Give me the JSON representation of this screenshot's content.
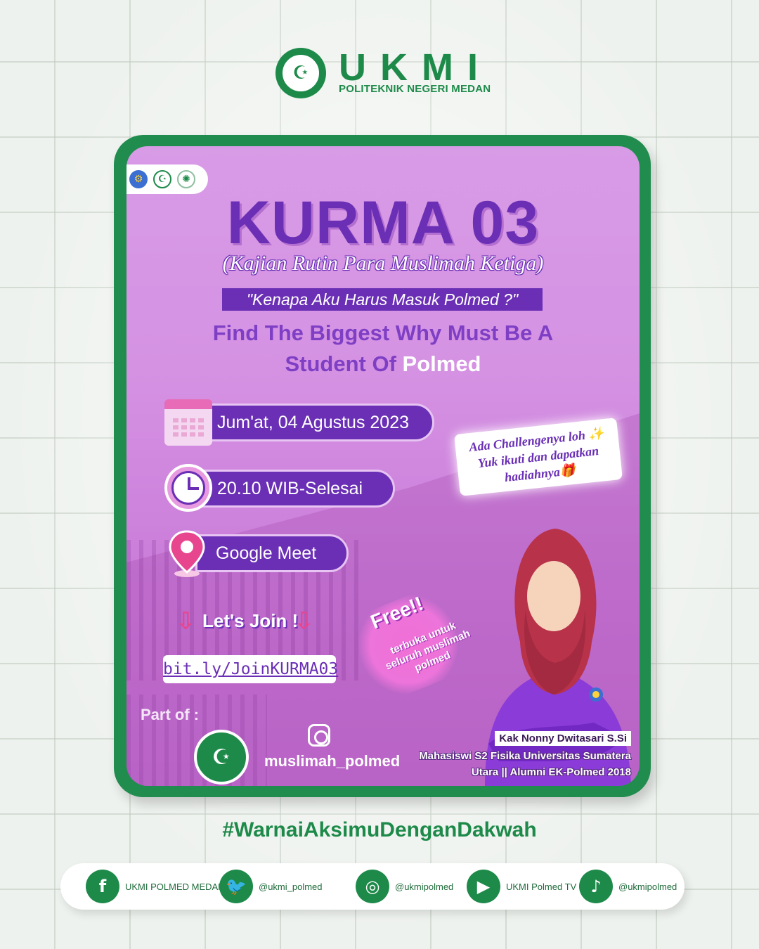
{
  "header": {
    "brand": "UKMI",
    "subtitle": "POLITEKNIK NEGERI MEDAN"
  },
  "poster": {
    "title": "KURMA 03",
    "subtitle": "(Kajian Rutin Para Muslimah Ketiga)",
    "quote": "\"Kenapa Aku Harus Masuk Polmed ?\"",
    "tagline_line1": "Find The Biggest Why Must Be A",
    "tagline_line2_a": "Student Of ",
    "tagline_line2_b": "Polmed",
    "date": "Jum'at, 04 Agustus 2023",
    "time": "20.10 WIB-Selesai",
    "place": "Google Meet",
    "join_label": "Let's Join !",
    "link": "bit.ly/JoinKURMA03",
    "part_of": "Part of :",
    "instagram": "muslimah_polmed",
    "challenge_line1": "Ada Challengenya loh ✨",
    "challenge_line2": "Yuk ikuti dan dapatkan",
    "challenge_line3": "hadiahnya🎁",
    "free_title": "Free!!",
    "free_sub": "terbuka untuk seluruh muslimah polmed",
    "speaker_name": "Kak Nonny Dwitasari S.Si",
    "speaker_desc1": "Mahasiswi S2 Fisika Universitas Sumatera",
    "speaker_desc2": "Utara || Alumni EK-Polmed 2018"
  },
  "hashtag": "#WarnaiAksimuDenganDakwah",
  "social": [
    {
      "icon": "facebook-icon",
      "glyph": "f",
      "label": "UKMI POLMED MEDAN"
    },
    {
      "icon": "twitter-icon",
      "glyph": "🐦",
      "label": "@ukmi_polmed"
    },
    {
      "icon": "instagram-icon",
      "glyph": "◎",
      "label": "@ukmipolmed"
    },
    {
      "icon": "youtube-icon",
      "glyph": "▶",
      "label": "UKMI Polmed TV"
    },
    {
      "icon": "tiktok-icon",
      "glyph": "♪",
      "label": "@ukmipolmed"
    }
  ],
  "colors": {
    "green": "#1e8a4a",
    "purple": "#6a2fb5",
    "pink": "#e8458f"
  }
}
